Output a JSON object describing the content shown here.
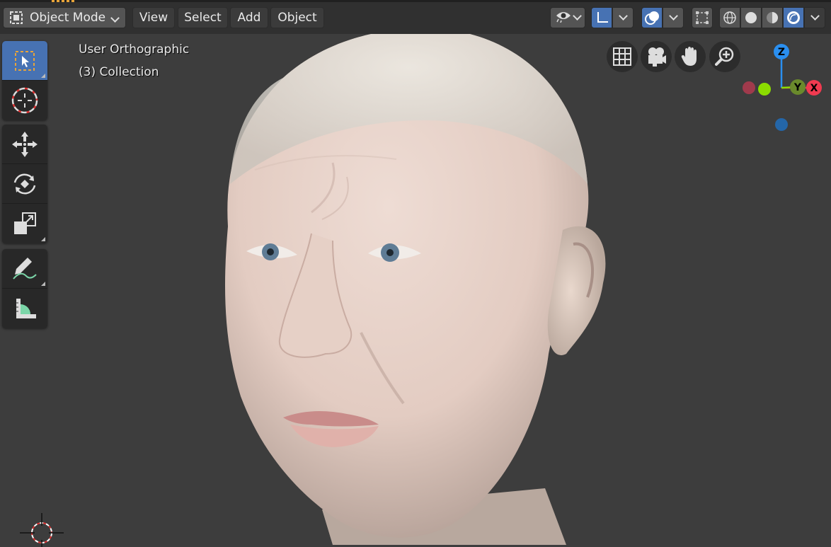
{
  "header": {
    "mode_label": "Object Mode",
    "menus": [
      "View",
      "Select",
      "Add",
      "Object"
    ]
  },
  "viewport": {
    "view_name": "User Orthographic",
    "collection": "(3) Collection"
  },
  "toolbar": {
    "tools": [
      "select-box",
      "cursor",
      "move",
      "rotate",
      "scale",
      "annotate",
      "measure"
    ]
  },
  "navigation": {
    "buttons": [
      "grid-toggle",
      "camera-view",
      "pan",
      "zoom"
    ]
  },
  "gizmo": {
    "axes": {
      "z": "Z",
      "y": "Y",
      "x": "X"
    },
    "colors": {
      "x": "#f03a50",
      "y": "#8bdc00",
      "z": "#2a8ff0"
    }
  },
  "colors": {
    "accent": "#4772b3",
    "header_bg": "#303030",
    "viewport_bg": "#3d3d3d"
  }
}
